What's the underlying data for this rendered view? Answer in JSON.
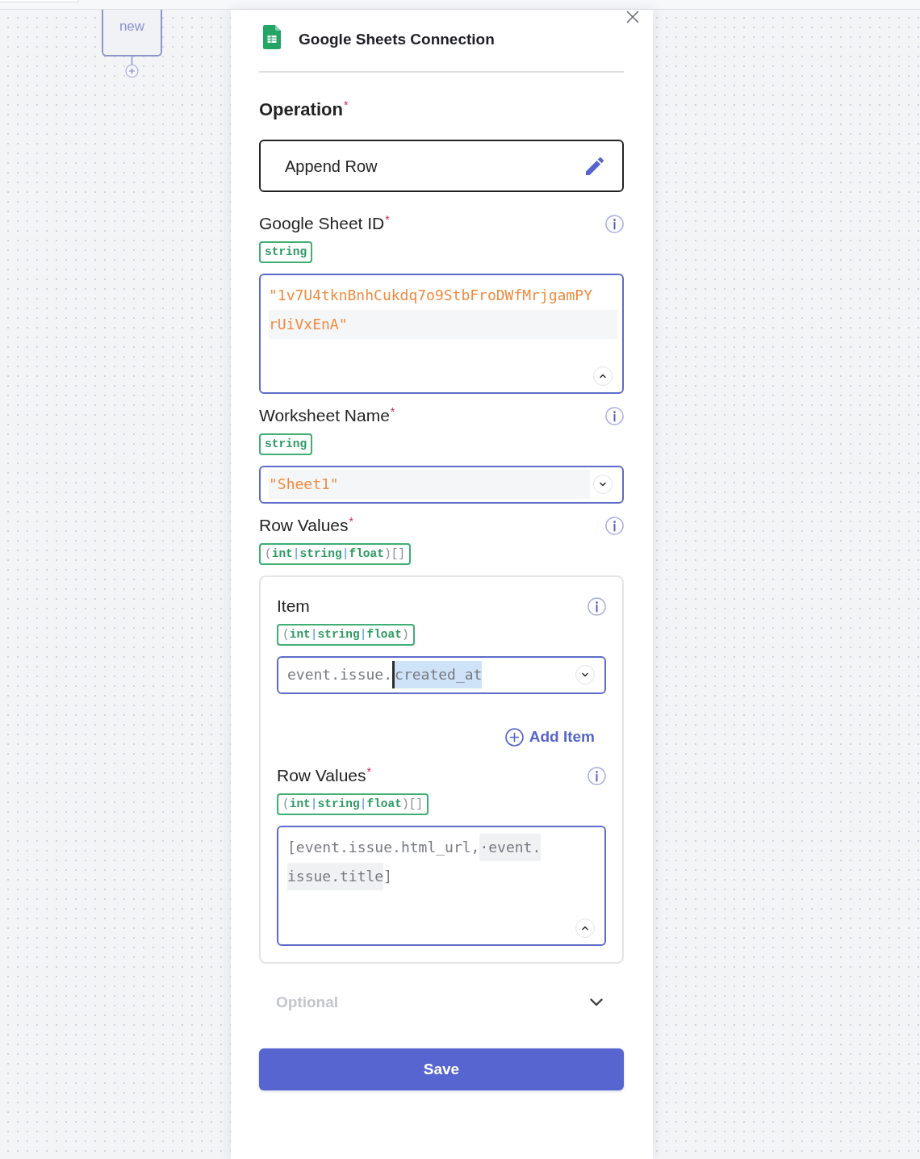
{
  "canvas": {
    "node": {
      "label": "new"
    }
  },
  "panel": {
    "title": "Google Sheets Connection",
    "operation": {
      "label": "Operation",
      "required_mark": "*",
      "value": "Append Row"
    },
    "fields": [
      {
        "kind": "field",
        "label": "Google Sheet ID",
        "required_mark": "*",
        "type": "string",
        "input": {
          "expanded": true,
          "literal": true,
          "lines": [
            {
              "active": false,
              "segments": [
                {
                  "text": "\"1v7U4tknBnhCukdq7o9StbFroDWfMrjgamPY"
                }
              ]
            },
            {
              "active": true,
              "segments": [
                {
                  "text": "rUiVxEnA\""
                }
              ]
            }
          ]
        }
      },
      {
        "kind": "field",
        "label": "Worksheet Name",
        "required_mark": "*",
        "type": "string",
        "input": {
          "expanded": false,
          "literal": true,
          "lines": [
            {
              "active": true,
              "segments": [
                {
                  "text": "\"Sheet1\""
                }
              ]
            }
          ]
        }
      },
      {
        "kind": "group",
        "label": "Row Values",
        "required_mark": "*",
        "type": "(int|string|float)[]",
        "children": [
          {
            "kind": "field",
            "label": "Item",
            "type": "(int|string|float)",
            "input": {
              "expanded": false,
              "literal": false,
              "lines": [
                {
                  "active": false,
                  "segments": [
                    {
                      "text": "event.issue.",
                      "selected": false,
                      "cursor": false
                    },
                    {
                      "text": "created_at",
                      "selected": true,
                      "cursor": true
                    }
                  ]
                }
              ]
            }
          },
          {
            "kind": "add_button",
            "label": "Add Item"
          },
          {
            "kind": "field",
            "label": "Row Values",
            "required_mark": "*",
            "type": "(int|string|float)[]",
            "input": {
              "expanded": true,
              "literal": false,
              "lines": [
                {
                  "active": false,
                  "segments": [
                    {
                      "text": "[event.issue.html_url,",
                      "highlighted": false
                    },
                    {
                      "text": "·event.",
                      "highlighted": true
                    }
                  ]
                },
                {
                  "active": false,
                  "segments": [
                    {
                      "text": "issue.title",
                      "highlighted": true
                    },
                    {
                      "text": "]",
                      "highlighted": false
                    }
                  ]
                }
              ]
            }
          }
        ]
      }
    ],
    "optional": {
      "label": "Optional",
      "expanded": false
    },
    "save": {
      "label": "Save"
    }
  }
}
